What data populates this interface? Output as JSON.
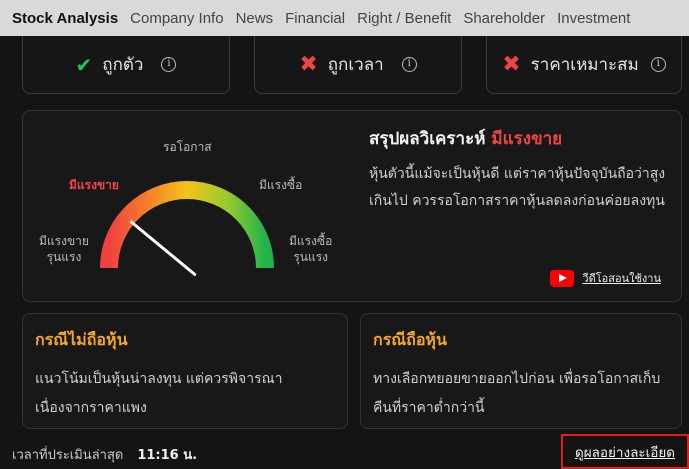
{
  "tabs": [
    "Stock Analysis",
    "Company Info",
    "News",
    "Financial",
    "Right / Benefit",
    "Shareholder",
    "Investment"
  ],
  "status_cards": [
    {
      "label": "ถูกตัว",
      "mark": "✔"
    },
    {
      "label": "ถูกเวลา",
      "mark": "✖"
    },
    {
      "label": "ราคาเหมาะสม",
      "mark": "✖"
    }
  ],
  "info_glyph": "i",
  "gauge": {
    "level": 0.22,
    "labels": {
      "top": "รอโอกาส",
      "left_mid": "มีแรงขาย",
      "right_mid": "มีแรงซื้อ",
      "left_low": [
        "มีแรงขาย",
        "รุนแรง"
      ],
      "right_low": [
        "มีแรงซื้อ",
        "รุนแรง"
      ]
    }
  },
  "summary": {
    "title": "สรุปผลวิเคราะห์",
    "verdict": "มีแรงขาย",
    "text": "หุ้นตัวนี้แม้จะเป็นหุ้นดี แต่ราคาหุ้นปัจจุบันถือว่าสูงเกินไป ควรรอโอกาสราคาหุ้นลดลงก่อนค่อยลงทุน"
  },
  "video_link": "วีดีโอสอนใช้งาน",
  "cases": [
    {
      "title": "กรณีไม่ถือหุ้น",
      "text": "แนวโน้มเป็นหุ้นน่าลงทุน แต่ควรพิจารณาเนื่องจากราคาแพง"
    },
    {
      "title": "กรณีถือหุ้น",
      "text": "ทางเลือกทยอยขายออกไปก่อน เพื่อรอโอกาสเก็บคืนที่ราคาต่ำกว่านี้"
    }
  ],
  "footer": {
    "label": "เวลาที่ประเมินล่าสุด",
    "time": "11:16 น."
  },
  "detail_link": "ดูผลอย่างละเอียด",
  "colors": {
    "sell": "#ef4444",
    "buy": "#22c55e",
    "case_title": "#f5a623",
    "highlight_border": "#e11d1d"
  }
}
